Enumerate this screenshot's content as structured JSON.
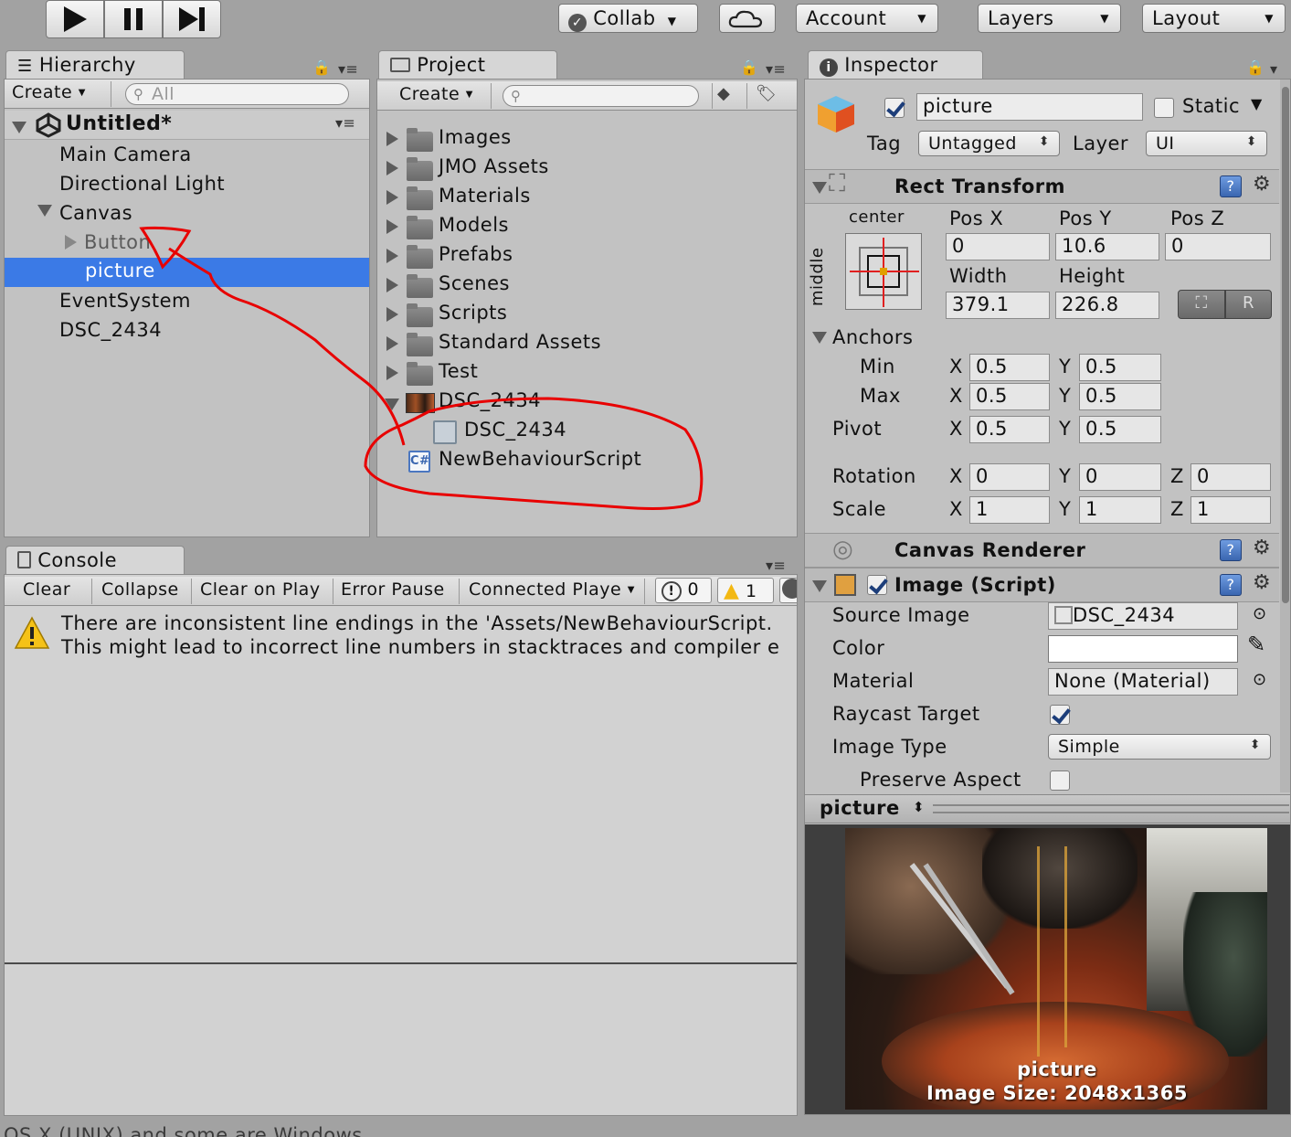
{
  "toolbar": {
    "collab_label": "Collab",
    "account_label": "Account",
    "layers_label": "Layers",
    "layout_label": "Layout"
  },
  "hierarchy": {
    "tab_label": "Hierarchy",
    "create_label": "Create",
    "search_placeholder": "All",
    "scene_name": "Untitled*",
    "items": [
      {
        "label": "Main Camera"
      },
      {
        "label": "Directional Light"
      },
      {
        "label": "Canvas"
      },
      {
        "label": "Button"
      },
      {
        "label": "picture"
      },
      {
        "label": "EventSystem"
      },
      {
        "label": "DSC_2434"
      }
    ]
  },
  "project": {
    "tab_label": "Project",
    "create_label": "Create",
    "items": [
      {
        "label": "Images"
      },
      {
        "label": "JMO Assets"
      },
      {
        "label": "Materials"
      },
      {
        "label": "Models"
      },
      {
        "label": "Prefabs"
      },
      {
        "label": "Scenes"
      },
      {
        "label": "Scripts"
      },
      {
        "label": "Standard Assets"
      },
      {
        "label": "Test"
      },
      {
        "label": "DSC_2434"
      },
      {
        "label": "DSC_2434"
      },
      {
        "label": "NewBehaviourScript"
      }
    ]
  },
  "console": {
    "tab_label": "Console",
    "buttons": {
      "clear": "Clear",
      "collapse": "Collapse",
      "clear_on_play": "Clear on Play",
      "error_pause": "Error Pause",
      "connected_player": "Connected Playe"
    },
    "error_count": "0",
    "warning_count": "1",
    "message_line1": "There are inconsistent line endings in the 'Assets/NewBehaviourScript.",
    "message_line2": "This might lead to incorrect line numbers in stacktraces and compiler e"
  },
  "status_bar": {
    "text": "OS X (UNIX) and some are Windows."
  },
  "inspector": {
    "tab_label": "Inspector",
    "object_name": "picture",
    "static_label": "Static",
    "tag_label": "Tag",
    "tag_value": "Untagged",
    "layer_label": "Layer",
    "layer_value": "UI",
    "rect_transform": {
      "title": "Rect Transform",
      "anchor_h": "center",
      "anchor_v": "middle",
      "pos_x_label": "Pos X",
      "pos_y_label": "Pos Y",
      "pos_z_label": "Pos Z",
      "pos_x": "0",
      "pos_y": "10.6",
      "pos_z": "0",
      "width_label": "Width",
      "height_label": "Height",
      "width": "379.1",
      "height": "226.8",
      "r_button": "R",
      "anchors_label": "Anchors",
      "min_label": "Min",
      "max_label": "Max",
      "pivot_label": "Pivot",
      "x_letter": "X",
      "y_letter": "Y",
      "z_letter": "Z",
      "min_x": "0.5",
      "min_y": "0.5",
      "max_x": "0.5",
      "max_y": "0.5",
      "pivot_x": "0.5",
      "pivot_y": "0.5",
      "rotation_label": "Rotation",
      "rot_x": "0",
      "rot_y": "0",
      "rot_z": "0",
      "scale_label": "Scale",
      "scale_x": "1",
      "scale_y": "1",
      "scale_z": "1"
    },
    "canvas_renderer": {
      "title": "Canvas Renderer"
    },
    "image_script": {
      "title": "Image (Script)",
      "source_image_label": "Source Image",
      "source_image_value": "DSC_2434",
      "color_label": "Color",
      "color_value": "#ffffff",
      "material_label": "Material",
      "material_value": "None (Material)",
      "raycast_label": "Raycast Target",
      "image_type_label": "Image Type",
      "image_type_value": "Simple",
      "preserve_label": "Preserve Aspect"
    },
    "preview": {
      "name": "picture",
      "caption_name": "picture",
      "caption_size": "Image Size: 2048x1365"
    }
  },
  "colors": {
    "selection": "#3b7ae6",
    "annotation": "#e80000"
  }
}
